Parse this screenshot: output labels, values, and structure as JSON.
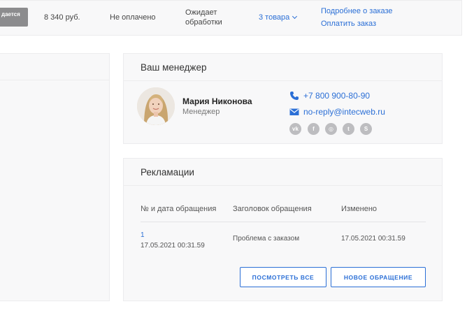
{
  "order": {
    "status_badge_line1": "дается",
    "status_badge_line2": "",
    "price": "8 340 руб.",
    "payment_status": "Не оплачено",
    "processing_status": "Ожидает обработки",
    "goods_count": "3 товара",
    "details_link": "Подробнее о заказе",
    "pay_link": "Оплатить заказ"
  },
  "manager": {
    "title": "Ваш менеджер",
    "name": "Мария Никонова",
    "role": "Менеджер",
    "phone": "+7 800 900-80-90",
    "email": "no-reply@intecweb.ru",
    "socials": [
      {
        "icon": "vk-icon",
        "glyph": "vk"
      },
      {
        "icon": "facebook-icon",
        "glyph": "f"
      },
      {
        "icon": "instagram-icon",
        "glyph": "◎"
      },
      {
        "icon": "twitter-icon",
        "glyph": "t"
      },
      {
        "icon": "skype-icon",
        "glyph": "S"
      }
    ]
  },
  "claims": {
    "title": "Рекламации",
    "headers": [
      "№ и дата обращения",
      "Заголовок обращения",
      "Изменено"
    ],
    "rows": [
      {
        "number": "1",
        "date": "17.05.2021 00:31.59",
        "subject": "Проблема с заказом",
        "changed": "17.05.2021 00:31.59"
      }
    ],
    "view_all_button": "ПОСМОТРЕТЬ ВСЕ",
    "new_request_button": "НОВОЕ ОБРАЩЕНИЕ"
  },
  "colors": {
    "accent": "#2b6fd6",
    "panel_bg": "#f8f8f9",
    "badge_bg": "#8c8c8e",
    "social_bg": "#bdbdc0"
  }
}
